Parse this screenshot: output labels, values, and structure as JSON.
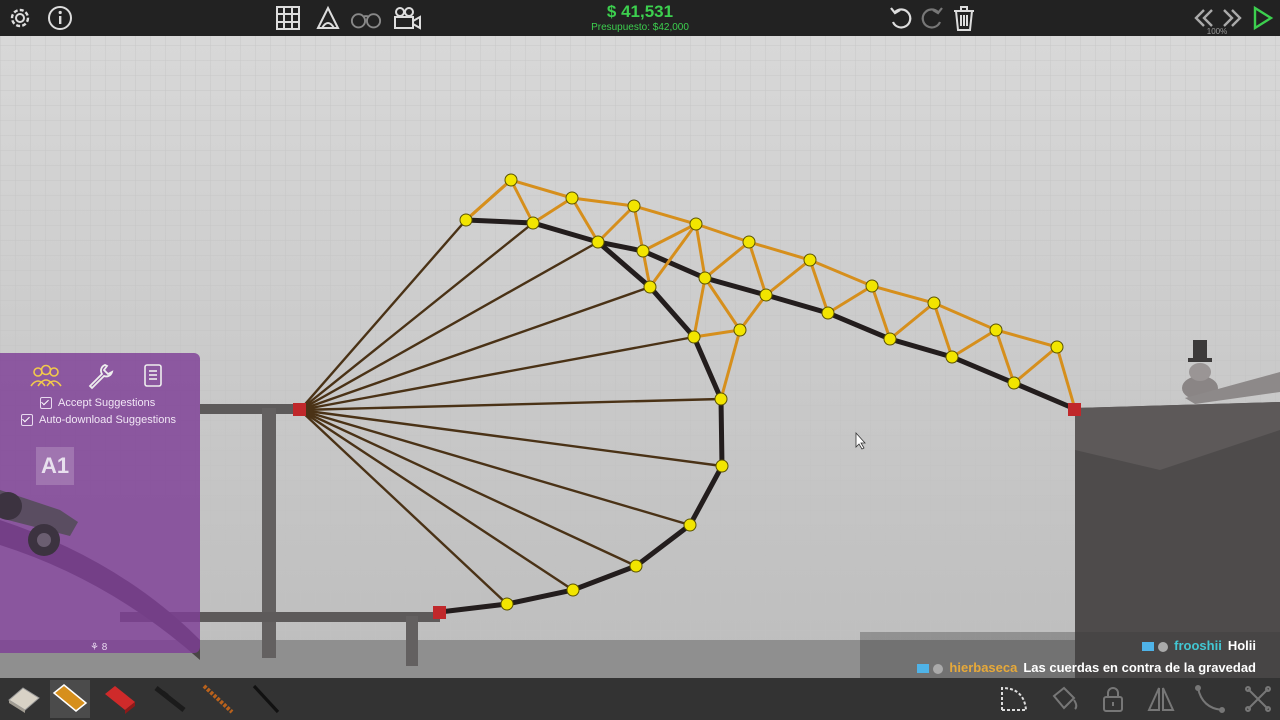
{
  "toolbar": {
    "left_icons": [
      "gear-icon",
      "info-icon"
    ],
    "center_icons": [
      "grid-icon",
      "stress-icon",
      "binoculars-icon",
      "camera-icon"
    ],
    "right_icons": [
      "undo-icon",
      "redo-icon",
      "trash-icon"
    ],
    "playback_icons": [
      "rewind-icon",
      "fast-forward-icon",
      "play-icon"
    ]
  },
  "budget": {
    "money": "$ 41,531",
    "label": "Presupuesto: $42,000"
  },
  "zoom": "100%",
  "workshop_panel": {
    "icons": [
      "workshop-users-icon",
      "wrench-icon",
      "notes-icon"
    ],
    "accept_label": "Accept Suggestions",
    "autodownload_label": "Auto-download Suggestions",
    "level": "A1",
    "count": "8"
  },
  "chat": [
    {
      "user": "frooshii",
      "message": "Holii"
    },
    {
      "user": "hierbaseca",
      "message": "Las cuerdas en contra de la gravedad"
    }
  ],
  "materials": [
    "road-material",
    "wood-material",
    "reinforced-road-material",
    "steel-material",
    "rope-material",
    "cable-material"
  ],
  "selected_material": "wood-material",
  "edit_tools": [
    "arc-tool-icon",
    "paint-bucket-icon",
    "lock-icon",
    "mirror-icon",
    "curve-tool-icon",
    "close-x-icon"
  ],
  "colors": {
    "budget": "#3ccf4e",
    "wood": "#d68f1c",
    "road": "#231d1d",
    "rope": "#4a3216",
    "joint": "#f2e500",
    "anchor": "#c0282b",
    "panel": "#7e3e96"
  }
}
